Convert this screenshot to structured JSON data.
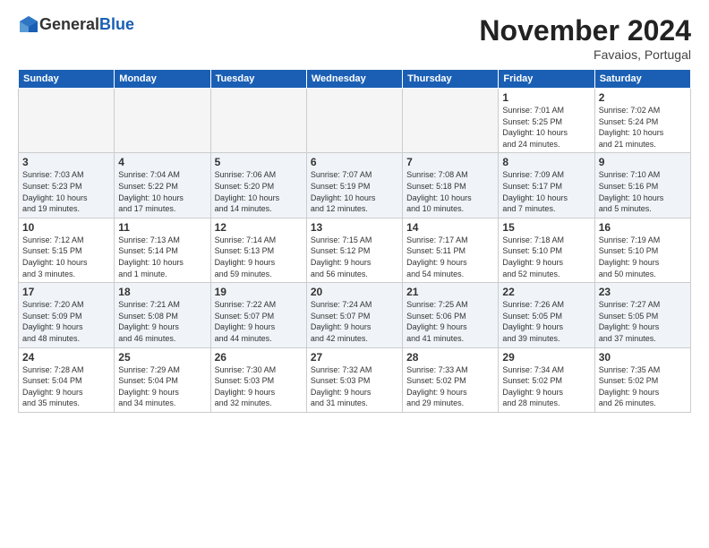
{
  "logo": {
    "general": "General",
    "blue": "Blue"
  },
  "header": {
    "month": "November 2024",
    "location": "Favaios, Portugal"
  },
  "weekdays": [
    "Sunday",
    "Monday",
    "Tuesday",
    "Wednesday",
    "Thursday",
    "Friday",
    "Saturday"
  ],
  "weeks": [
    [
      {
        "day": "",
        "empty": true
      },
      {
        "day": "",
        "empty": true
      },
      {
        "day": "",
        "empty": true
      },
      {
        "day": "",
        "empty": true
      },
      {
        "day": "",
        "empty": true
      },
      {
        "day": "1",
        "info": "Sunrise: 7:01 AM\nSunset: 5:25 PM\nDaylight: 10 hours\nand 24 minutes."
      },
      {
        "day": "2",
        "info": "Sunrise: 7:02 AM\nSunset: 5:24 PM\nDaylight: 10 hours\nand 21 minutes."
      }
    ],
    [
      {
        "day": "3",
        "info": "Sunrise: 7:03 AM\nSunset: 5:23 PM\nDaylight: 10 hours\nand 19 minutes."
      },
      {
        "day": "4",
        "info": "Sunrise: 7:04 AM\nSunset: 5:22 PM\nDaylight: 10 hours\nand 17 minutes."
      },
      {
        "day": "5",
        "info": "Sunrise: 7:06 AM\nSunset: 5:20 PM\nDaylight: 10 hours\nand 14 minutes."
      },
      {
        "day": "6",
        "info": "Sunrise: 7:07 AM\nSunset: 5:19 PM\nDaylight: 10 hours\nand 12 minutes."
      },
      {
        "day": "7",
        "info": "Sunrise: 7:08 AM\nSunset: 5:18 PM\nDaylight: 10 hours\nand 10 minutes."
      },
      {
        "day": "8",
        "info": "Sunrise: 7:09 AM\nSunset: 5:17 PM\nDaylight: 10 hours\nand 7 minutes."
      },
      {
        "day": "9",
        "info": "Sunrise: 7:10 AM\nSunset: 5:16 PM\nDaylight: 10 hours\nand 5 minutes."
      }
    ],
    [
      {
        "day": "10",
        "info": "Sunrise: 7:12 AM\nSunset: 5:15 PM\nDaylight: 10 hours\nand 3 minutes."
      },
      {
        "day": "11",
        "info": "Sunrise: 7:13 AM\nSunset: 5:14 PM\nDaylight: 10 hours\nand 1 minute."
      },
      {
        "day": "12",
        "info": "Sunrise: 7:14 AM\nSunset: 5:13 PM\nDaylight: 9 hours\nand 59 minutes."
      },
      {
        "day": "13",
        "info": "Sunrise: 7:15 AM\nSunset: 5:12 PM\nDaylight: 9 hours\nand 56 minutes."
      },
      {
        "day": "14",
        "info": "Sunrise: 7:17 AM\nSunset: 5:11 PM\nDaylight: 9 hours\nand 54 minutes."
      },
      {
        "day": "15",
        "info": "Sunrise: 7:18 AM\nSunset: 5:10 PM\nDaylight: 9 hours\nand 52 minutes."
      },
      {
        "day": "16",
        "info": "Sunrise: 7:19 AM\nSunset: 5:10 PM\nDaylight: 9 hours\nand 50 minutes."
      }
    ],
    [
      {
        "day": "17",
        "info": "Sunrise: 7:20 AM\nSunset: 5:09 PM\nDaylight: 9 hours\nand 48 minutes."
      },
      {
        "day": "18",
        "info": "Sunrise: 7:21 AM\nSunset: 5:08 PM\nDaylight: 9 hours\nand 46 minutes."
      },
      {
        "day": "19",
        "info": "Sunrise: 7:22 AM\nSunset: 5:07 PM\nDaylight: 9 hours\nand 44 minutes."
      },
      {
        "day": "20",
        "info": "Sunrise: 7:24 AM\nSunset: 5:07 PM\nDaylight: 9 hours\nand 42 minutes."
      },
      {
        "day": "21",
        "info": "Sunrise: 7:25 AM\nSunset: 5:06 PM\nDaylight: 9 hours\nand 41 minutes."
      },
      {
        "day": "22",
        "info": "Sunrise: 7:26 AM\nSunset: 5:05 PM\nDaylight: 9 hours\nand 39 minutes."
      },
      {
        "day": "23",
        "info": "Sunrise: 7:27 AM\nSunset: 5:05 PM\nDaylight: 9 hours\nand 37 minutes."
      }
    ],
    [
      {
        "day": "24",
        "info": "Sunrise: 7:28 AM\nSunset: 5:04 PM\nDaylight: 9 hours\nand 35 minutes."
      },
      {
        "day": "25",
        "info": "Sunrise: 7:29 AM\nSunset: 5:04 PM\nDaylight: 9 hours\nand 34 minutes."
      },
      {
        "day": "26",
        "info": "Sunrise: 7:30 AM\nSunset: 5:03 PM\nDaylight: 9 hours\nand 32 minutes."
      },
      {
        "day": "27",
        "info": "Sunrise: 7:32 AM\nSunset: 5:03 PM\nDaylight: 9 hours\nand 31 minutes."
      },
      {
        "day": "28",
        "info": "Sunrise: 7:33 AM\nSunset: 5:02 PM\nDaylight: 9 hours\nand 29 minutes."
      },
      {
        "day": "29",
        "info": "Sunrise: 7:34 AM\nSunset: 5:02 PM\nDaylight: 9 hours\nand 28 minutes."
      },
      {
        "day": "30",
        "info": "Sunrise: 7:35 AM\nSunset: 5:02 PM\nDaylight: 9 hours\nand 26 minutes."
      }
    ]
  ]
}
